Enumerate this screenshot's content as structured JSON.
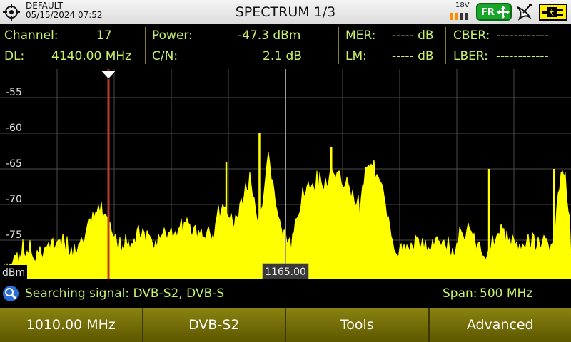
{
  "header": {
    "profile_name": "DEFAULT",
    "datetime": "05/15/2024 07:52",
    "title": "SPECTRUM 1/3",
    "lnb_voltage": "18V",
    "band_badge": "FR",
    "icons": [
      "gps-icon",
      "battery-icon",
      "band-badge-icon",
      "satellite-dish-icon",
      "power-plug-icon"
    ]
  },
  "measurements": {
    "channel_label": "Channel:",
    "channel_value": "17",
    "dl_label": "DL:",
    "dl_value": "4140.00 MHz",
    "power_label": "Power:",
    "power_value": "-47.3 dBm",
    "cn_label": "C/N:",
    "cn_value": "2.1 dB",
    "mer_label": "MER:",
    "mer_value": "----- dB",
    "lm_label": "LM:",
    "lm_value": "----- dB",
    "cber_label": "CBER:",
    "cber_value": "------------",
    "lber_label": "LBER:",
    "lber_value": "------------"
  },
  "status": {
    "message": "Searching signal: DVB-S2, DVB-S",
    "span_label": "Span:",
    "span_value": "500 MHz"
  },
  "softkeys": [
    "1010.00 MHz",
    "DVB-S2",
    "Tools",
    "Advanced"
  ],
  "colors": {
    "trace": "#ffff00",
    "text_accent": "#c8f06a",
    "marker": "#c0392b",
    "softkey_bg": "#6b6500"
  },
  "chart_data": {
    "type": "area",
    "ylabel": "dBm",
    "y_tick_labels": [
      "-55",
      "-60",
      "-65",
      "-70",
      "-75"
    ],
    "y_ticks": [
      -55,
      -60,
      -65,
      -70,
      -75
    ],
    "ylim": [
      -80.5,
      -51
    ],
    "xlim": [
      915,
      1415
    ],
    "center_label": "1165.00",
    "center_mhz": 1165,
    "marker_mhz": 1010,
    "grid": true,
    "x": [
      915,
      925,
      935,
      945,
      955,
      965,
      975,
      985,
      995,
      1000,
      1005,
      1010,
      1015,
      1020,
      1030,
      1040,
      1050,
      1060,
      1070,
      1080,
      1090,
      1100,
      1110,
      1120,
      1130,
      1135,
      1140,
      1145,
      1150,
      1160,
      1170,
      1180,
      1185,
      1190,
      1200,
      1210,
      1220,
      1230,
      1235,
      1240,
      1250,
      1260,
      1270,
      1280,
      1290,
      1300,
      1310,
      1320,
      1330,
      1340,
      1350,
      1360,
      1370,
      1380,
      1390,
      1400,
      1405,
      1410,
      1415
    ],
    "y": [
      -79,
      -77,
      -76,
      -76.5,
      -75,
      -74,
      -76,
      -75,
      -71,
      -70,
      -70.5,
      -72,
      -73.5,
      -75,
      -74,
      -73,
      -74.5,
      -73,
      -73,
      -72,
      -73,
      -74,
      -69,
      -72,
      -67,
      -66,
      -72,
      -70,
      -62,
      -72,
      -75,
      -67,
      -66.5,
      -67,
      -66,
      -65,
      -66,
      -70,
      -64,
      -62.5,
      -67,
      -76,
      -75,
      -74,
      -75,
      -74,
      -76,
      -73,
      -74,
      -76,
      -73,
      -73.5,
      -75,
      -75,
      -74,
      -75,
      -66,
      -64,
      -76,
      -73,
      -73,
      -74,
      -76,
      -74,
      -75,
      -74.5,
      -76,
      -73,
      -71,
      -67,
      -65,
      -66,
      -72,
      -76,
      -74
    ],
    "spikes_x": [
      1113,
      1142,
      1205,
      1343,
      1400
    ],
    "spikes_y": [
      -64,
      -60,
      -62,
      -65,
      -65
    ]
  }
}
